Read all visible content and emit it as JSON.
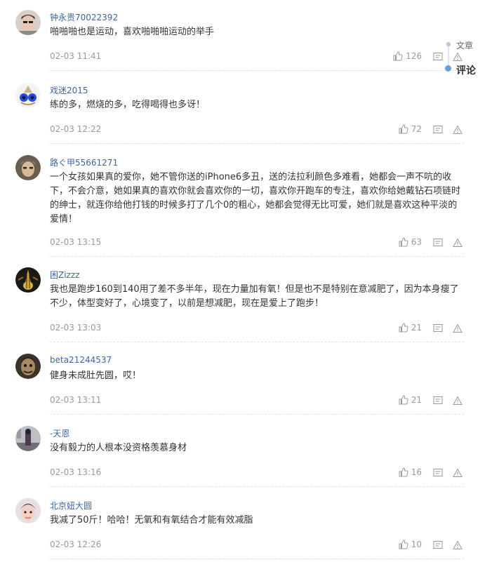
{
  "comments": [
    {
      "username": "钟永贵70022392",
      "content": "啪啪啪也是运动，喜欢啪啪啪运动的举手",
      "time": "02-03 11:41",
      "likes": "126",
      "avatar_icon": "avatar-photo"
    },
    {
      "username": "戏迷2015",
      "content": "练的多，燃烧的多，吃得喝得也多讶！",
      "time": "02-03 12:22",
      "likes": "72",
      "avatar_icon": "avatar-blue-earrings"
    },
    {
      "username": "路ぐ甲55661271",
      "content": "一个女孩如果真的爱你，她不管你送的iPhone6多丑，送的法拉利颜色多难看，她都会一声不吭的收下，不会介意，她如果真的喜欢你就会喜欢你的一切，喜欢你开跑车的专注，喜欢你给她戴钻石项链时的绅士，就连你给他打钱的时候多打了几个0的粗心，她都会觉得无比可爱，她们就是喜欢这种平淡的爱情！",
      "time": "02-03 13:15",
      "likes": "63",
      "avatar_icon": "avatar-photo"
    },
    {
      "username": "困Zizzz",
      "content": "我也是跑步160到140用了差不多半年，现在力量加有氧！但是也不是特别在意减肥了，因为本身瘦了不少，体型变好了，心境变了，以前是想减肥，现在是爱上了跑步！",
      "time": "02-03 13:03",
      "likes": "21",
      "avatar_icon": "avatar-guitar"
    },
    {
      "username": "beta21244537",
      "content": "健身未成肚先圆，哎！",
      "time": "02-03 13:11",
      "likes": "21",
      "avatar_icon": "avatar-photo"
    },
    {
      "username": "-天恩",
      "content": "没有毅力的人根本没资格羡慕身材",
      "time": "02-03 13:16",
      "likes": "16",
      "avatar_icon": "avatar-photo"
    },
    {
      "username": "北京妞大圆",
      "content": "我减了50斤！哈哈！无氧和有氧结合才能有效减脂",
      "time": "02-03 12:26",
      "likes": "10",
      "avatar_icon": "avatar-photo"
    }
  ],
  "side_nav": {
    "article": "文章",
    "comment": "评论"
  },
  "colors": {
    "username": "#406599",
    "meta": "#999999",
    "nav_active": "#6a9fdc"
  }
}
